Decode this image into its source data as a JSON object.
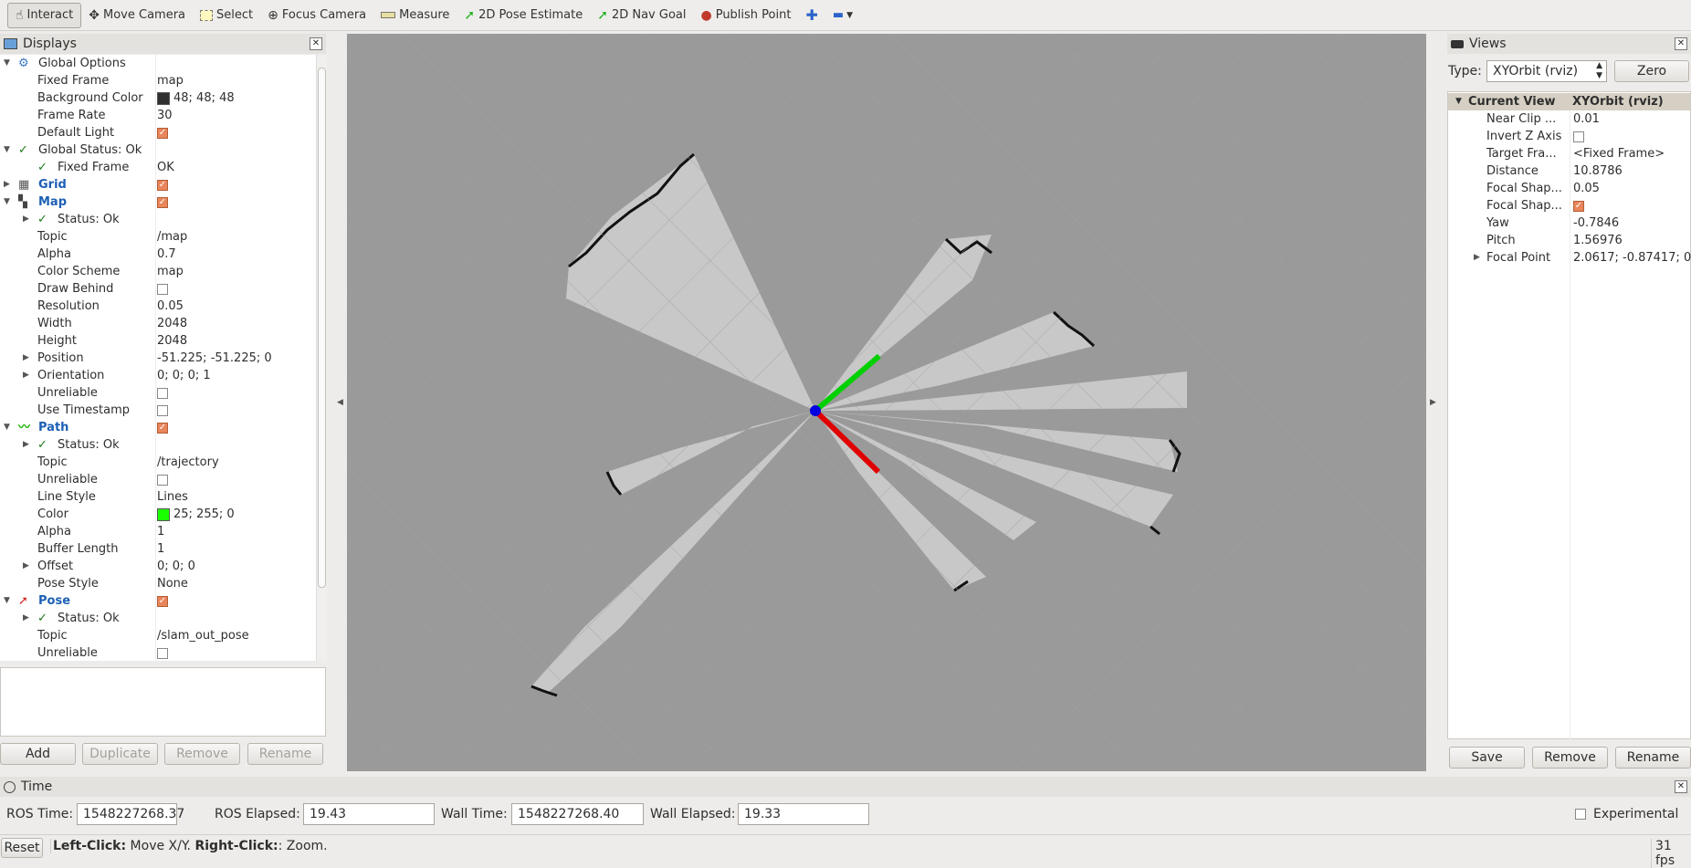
{
  "toolbar": {
    "tools": [
      {
        "label": "Interact",
        "icon": "hand-icon"
      },
      {
        "label": "Move Camera",
        "icon": "move-icon"
      },
      {
        "label": "Select",
        "icon": "select-icon"
      },
      {
        "label": "Focus Camera",
        "icon": "focus-icon"
      },
      {
        "label": "Measure",
        "icon": "ruler-icon"
      },
      {
        "label": "2D Pose Estimate",
        "icon": "pose-arrow-icon"
      },
      {
        "label": "2D Nav Goal",
        "icon": "nav-arrow-icon"
      },
      {
        "label": "Publish Point",
        "icon": "pin-icon"
      }
    ]
  },
  "displays": {
    "title": "Displays",
    "rows": [
      {
        "d": 0,
        "exp": "open",
        "icon": "gear-icon",
        "k": "Global Options",
        "v": ""
      },
      {
        "d": 1,
        "k": "Fixed Frame",
        "v": "map"
      },
      {
        "d": 1,
        "k": "Background Color",
        "v": "48; 48; 48",
        "swatch": "#303030"
      },
      {
        "d": 1,
        "k": "Frame Rate",
        "v": "30"
      },
      {
        "d": 1,
        "k": "Default Light",
        "chk": true
      },
      {
        "d": 0,
        "exp": "open",
        "icon": "check-icon",
        "k": "Global Status: Ok",
        "v": ""
      },
      {
        "d": 1,
        "icon": "check-icon",
        "k": "Fixed Frame",
        "v": "OK"
      },
      {
        "d": 0,
        "exp": "closed",
        "icon": "grid-icon",
        "k": "Grid",
        "blue": true,
        "chk": true
      },
      {
        "d": 0,
        "exp": "open",
        "icon": "map-icon",
        "k": "Map",
        "blue": true,
        "chk": true
      },
      {
        "d": 1,
        "exp": "closed",
        "icon": "check-icon",
        "k": "Status: Ok",
        "v": ""
      },
      {
        "d": 1,
        "k": "Topic",
        "v": "/map"
      },
      {
        "d": 1,
        "k": "Alpha",
        "v": "0.7"
      },
      {
        "d": 1,
        "k": "Color Scheme",
        "v": "map"
      },
      {
        "d": 1,
        "k": "Draw Behind",
        "chk": false
      },
      {
        "d": 1,
        "k": "Resolution",
        "v": "0.05"
      },
      {
        "d": 1,
        "k": "Width",
        "v": "2048"
      },
      {
        "d": 1,
        "k": "Height",
        "v": "2048"
      },
      {
        "d": 1,
        "exp": "closed",
        "k": "Position",
        "v": "-51.225; -51.225; 0"
      },
      {
        "d": 1,
        "exp": "closed",
        "k": "Orientation",
        "v": "0; 0; 0; 1"
      },
      {
        "d": 1,
        "k": "Unreliable",
        "chk": false
      },
      {
        "d": 1,
        "k": "Use Timestamp",
        "chk": false
      },
      {
        "d": 0,
        "exp": "open",
        "icon": "path-icon",
        "k": "Path",
        "blue": true,
        "chk": true
      },
      {
        "d": 1,
        "exp": "closed",
        "icon": "check-icon",
        "k": "Status: Ok",
        "v": ""
      },
      {
        "d": 1,
        "k": "Topic",
        "v": "/trajectory"
      },
      {
        "d": 1,
        "k": "Unreliable",
        "chk": false
      },
      {
        "d": 1,
        "k": "Line Style",
        "v": "Lines"
      },
      {
        "d": 1,
        "k": "Color",
        "v": "25; 255; 0",
        "swatch": "#19ff00"
      },
      {
        "d": 1,
        "k": "Alpha",
        "v": "1"
      },
      {
        "d": 1,
        "k": "Buffer Length",
        "v": "1"
      },
      {
        "d": 1,
        "exp": "closed",
        "k": "Offset",
        "v": "0; 0; 0"
      },
      {
        "d": 1,
        "k": "Pose Style",
        "v": "None"
      },
      {
        "d": 0,
        "exp": "open",
        "icon": "pose-icon",
        "k": "Pose",
        "blue": true,
        "chk": true
      },
      {
        "d": 1,
        "exp": "closed",
        "icon": "check-icon",
        "k": "Status: Ok",
        "v": ""
      },
      {
        "d": 1,
        "k": "Topic",
        "v": "/slam_out_pose"
      },
      {
        "d": 1,
        "k": "Unreliable",
        "chk": false
      }
    ],
    "buttons": {
      "add": "Add",
      "duplicate": "Duplicate",
      "remove": "Remove",
      "rename": "Rename"
    }
  },
  "views": {
    "title": "Views",
    "type_label": "Type:",
    "type_value": "XYOrbit (rviz)",
    "zero_label": "Zero",
    "header": {
      "k": "Current View",
      "v": "XYOrbit (rviz)"
    },
    "rows": [
      {
        "k": "Near Clip ...",
        "v": "0.01"
      },
      {
        "k": "Invert Z Axis",
        "chk": false
      },
      {
        "k": "Target Fra...",
        "v": "<Fixed Frame>"
      },
      {
        "k": "Distance",
        "v": "10.8786"
      },
      {
        "k": "Focal Shap...",
        "v": "0.05"
      },
      {
        "k": "Focal Shap...",
        "chk": true
      },
      {
        "k": "Yaw",
        "v": "-0.7846"
      },
      {
        "k": "Pitch",
        "v": "1.56976"
      },
      {
        "k": "Focal Point",
        "v": "2.0617; -0.87417; 0",
        "exp": "closed"
      }
    ],
    "buttons": {
      "save": "Save",
      "remove": "Remove",
      "rename": "Rename"
    }
  },
  "time": {
    "title": "Time",
    "ros_time_label": "ROS Time:",
    "ros_time": "1548227268.37",
    "ros_elapsed_label": "ROS Elapsed:",
    "ros_elapsed": "19.43",
    "wall_time_label": "Wall Time:",
    "wall_time": "1548227268.40",
    "wall_elapsed_label": "Wall Elapsed:",
    "wall_elapsed": "19.33",
    "experimental_label": "Experimental"
  },
  "status": {
    "reset_label": "Reset",
    "hint_bold1": "Left-Click:",
    "hint1": " Move X/Y. ",
    "hint_bold2": "Right-Click:",
    "hint2": ": Zoom.",
    "fps": "31 fps"
  },
  "colors": {
    "background": "#303030",
    "map_free": "#c8c8c8",
    "grid": "#a0a0a0",
    "x_axis": "#e00000",
    "y_axis": "#00d000",
    "z_axis": "#0000e0"
  }
}
